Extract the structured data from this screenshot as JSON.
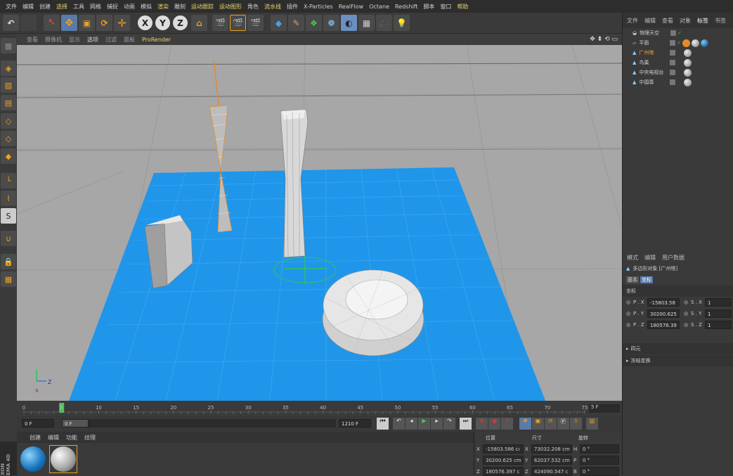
{
  "menu": [
    "文件",
    "编辑",
    "创建",
    "选择",
    "工具",
    "网格",
    "捕捉",
    "动画",
    "模拟",
    "渲染",
    "雕刻",
    "运动跟踪",
    "运动图形",
    "角色",
    "流水线",
    "插件",
    "X-Particles",
    "RealFlow",
    "Octane",
    "Redshift",
    "脚本",
    "窗口",
    "帮助"
  ],
  "toolbar": {
    "undo": "↶",
    "x": "X",
    "y": "Y",
    "z": "Z"
  },
  "viewport_menu": [
    "查看",
    "摄像机",
    "显示",
    "选项",
    "过滤",
    "面板"
  ],
  "prorender": "ProRender",
  "axes": {
    "z": "Z",
    "x": "X"
  },
  "objects": {
    "tabs": [
      "文件",
      "编辑",
      "查看",
      "对象",
      "标签",
      "书签"
    ],
    "items": [
      {
        "name": "物理天空",
        "selected": false
      },
      {
        "name": "平面",
        "selected": false
      },
      {
        "name": "广州塔",
        "selected": true
      },
      {
        "name": "鸟巢",
        "selected": false
      },
      {
        "name": "中央电视台",
        "selected": false
      },
      {
        "name": "中国尊",
        "selected": false
      }
    ]
  },
  "attributes": {
    "tabs": [
      "模式",
      "编辑",
      "用户数据"
    ],
    "object_title": "多边形对象 [广州塔]",
    "subtabs": [
      "基本",
      "坐标"
    ],
    "section": "坐标",
    "rows": [
      {
        "p_label": "P . X",
        "p_val": "-15803.58",
        "s_label": "S . X",
        "s_val": "1"
      },
      {
        "p_label": "P . Y",
        "p_val": "30200.625",
        "s_label": "S . Y",
        "s_val": "1"
      },
      {
        "p_label": "P . Z",
        "p_val": "180576.39",
        "s_label": "S . Z",
        "s_val": "1"
      }
    ],
    "groups": [
      "四元",
      "冻结变换"
    ]
  },
  "timeline": {
    "ticks": [
      "0",
      "5",
      "10",
      "15",
      "20",
      "25",
      "30",
      "35",
      "40",
      "45",
      "50",
      "55",
      "60",
      "65",
      "70",
      "75"
    ],
    "end_label": "5 F",
    "start_field": "0 F",
    "preview_field": "0 F",
    "end_field": "1210 F"
  },
  "materials_menu": [
    "创建",
    "编辑",
    "功能",
    "纹理"
  ],
  "coords": {
    "headers": [
      "位置",
      "尺寸",
      "旋转"
    ],
    "rows": [
      {
        "axis": "X",
        "pos": "-15803.586 cı",
        "size": "73032.208 cm",
        "rot_axis": "H",
        "rot": "0 °"
      },
      {
        "axis": "Y",
        "pos": "30200.625 cm",
        "size": "62037.532 cm",
        "rot_axis": "P",
        "rot": "0 °"
      },
      {
        "axis": "Z",
        "pos": "180576.397 c",
        "size": "424090.547 c",
        "rot_axis": "B",
        "rot": "0 °"
      }
    ]
  },
  "brand": "XON\nEMA 4D",
  "colors": {
    "plane": "#1f96ea",
    "viewport": "#a7a7a7",
    "selected": "#f0a830",
    "highlight": "#e8d66a",
    "playhead": "#4ec25e"
  }
}
